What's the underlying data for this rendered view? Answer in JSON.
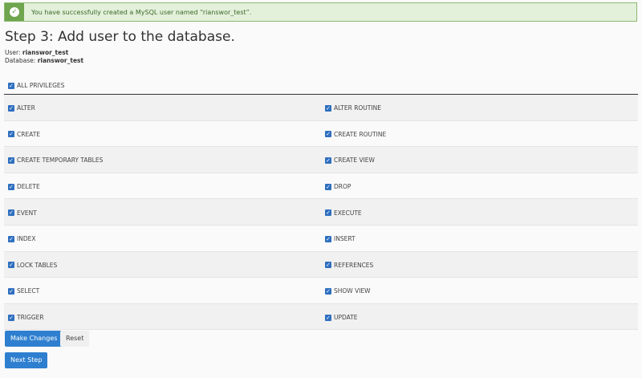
{
  "alert": {
    "message": "You have successfully created a MySQL user named “rianswor_test”.",
    "icon": "check-circle-icon"
  },
  "title": "Step 3: Add user to the database.",
  "user_label": "User:",
  "user": "rianswor_test",
  "db_label": "Database:",
  "database": "rianswor_test",
  "all_privileges": "ALL PRIVILEGES",
  "privileges": [
    [
      "ALTER",
      "ALTER ROUTINE"
    ],
    [
      "CREATE",
      "CREATE ROUTINE"
    ],
    [
      "CREATE TEMPORARY TABLES",
      "CREATE VIEW"
    ],
    [
      "DELETE",
      "DROP"
    ],
    [
      "EVENT",
      "EXECUTE"
    ],
    [
      "INDEX",
      "INSERT"
    ],
    [
      "LOCK TABLES",
      "REFERENCES"
    ],
    [
      "SELECT",
      "SHOW VIEW"
    ],
    [
      "TRIGGER",
      "UPDATE"
    ]
  ],
  "buttons": {
    "make_changes": "Make Changes",
    "reset": "Reset",
    "next_step": "Next Step"
  }
}
